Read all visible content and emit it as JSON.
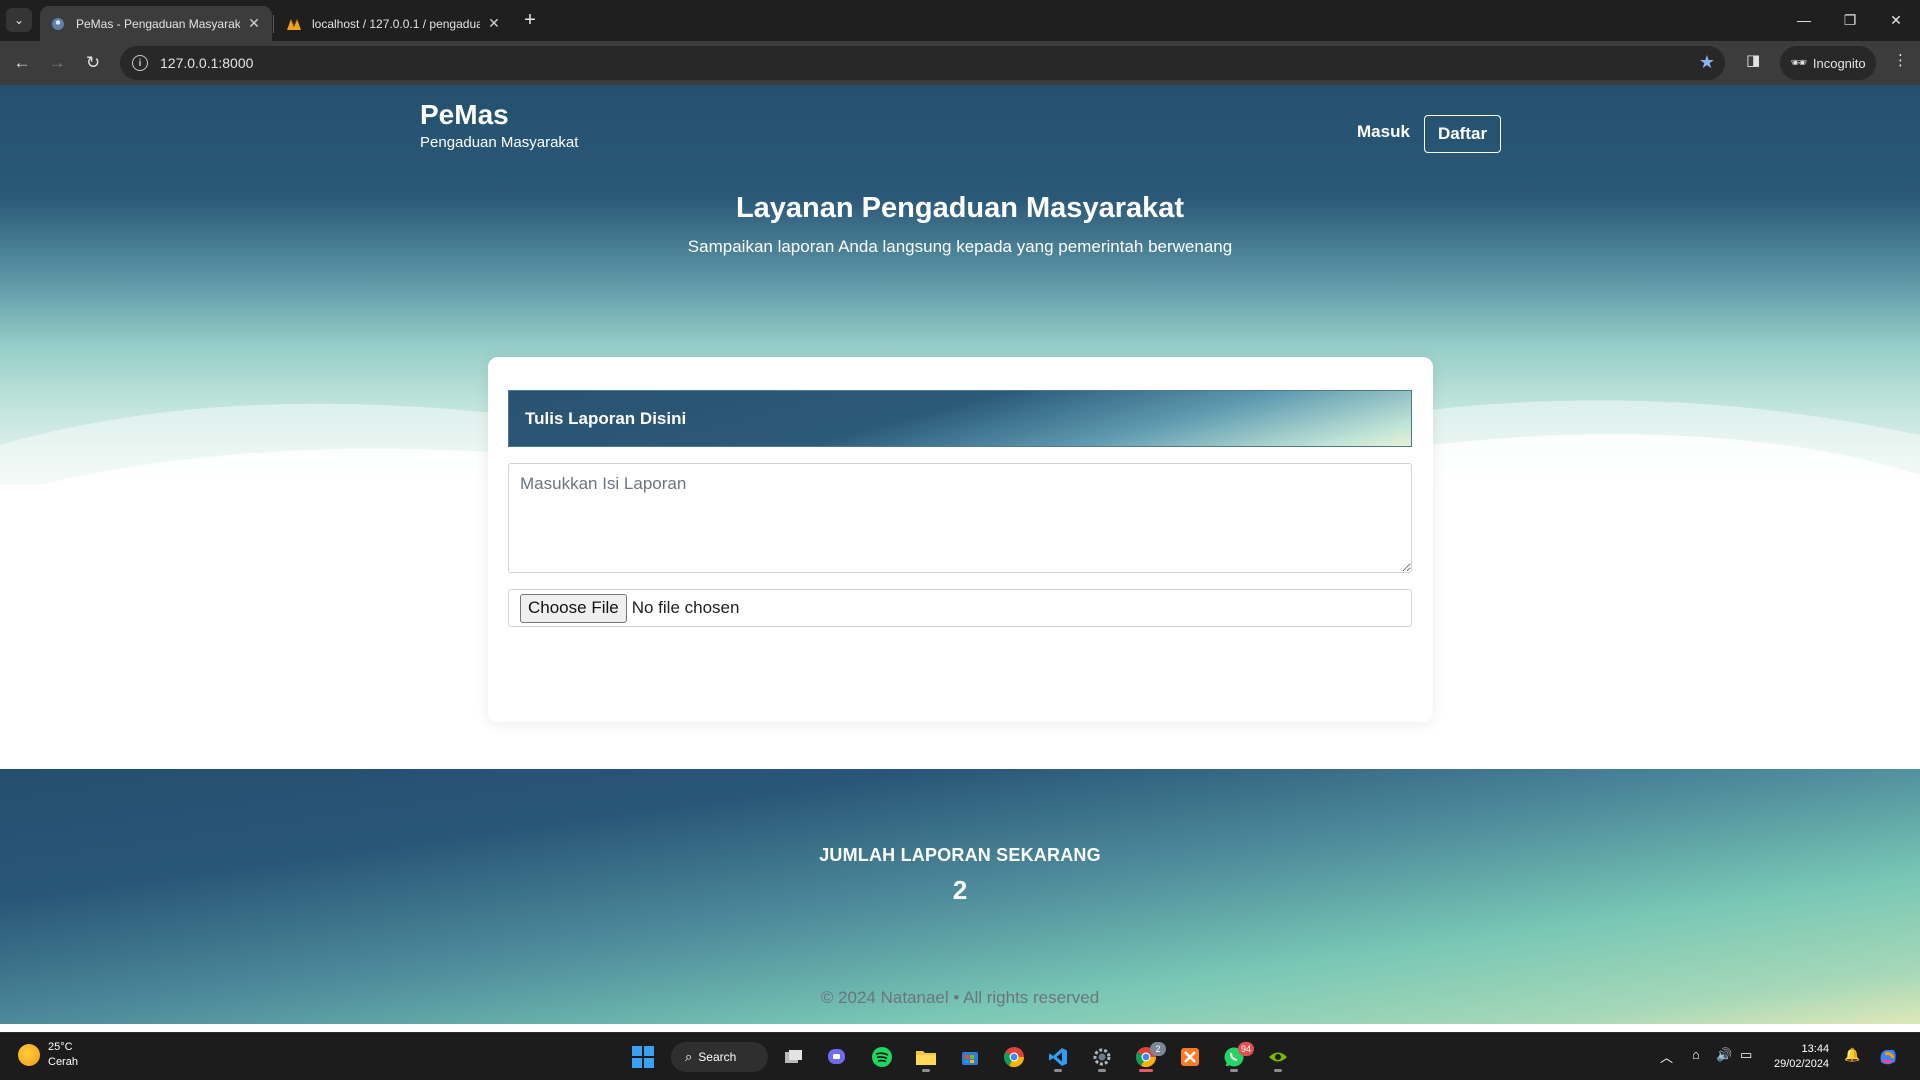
{
  "browser": {
    "tabs": [
      {
        "title": "PeMas - Pengaduan Masyarakat",
        "active": true
      },
      {
        "title": "localhost / 127.0.0.1 / pengaduan",
        "active": false
      }
    ],
    "url": "127.0.0.1:8000",
    "incognito_label": "Incognito"
  },
  "navbar": {
    "brand_title": "PeMas",
    "brand_subtitle": "Pengaduan Masyarakat",
    "login_label": "Masuk",
    "register_label": "Daftar"
  },
  "hero": {
    "title": "Layanan Pengaduan Masyarakat",
    "subtitle": "Sampaikan laporan Anda langsung kepada yang pemerintah berwenang"
  },
  "report_form": {
    "header": "Tulis Laporan Disini",
    "textarea_placeholder": "Masukkan Isi Laporan",
    "file_button_label": "Choose File",
    "file_status": "No file chosen"
  },
  "stats": {
    "label": "JUMLAH LAPORAN SEKARANG",
    "count": "2"
  },
  "footer": {
    "text": "© 2024 Natanael • All rights reserved"
  },
  "taskbar": {
    "weather_temp": "25°C",
    "weather_desc": "Cerah",
    "search_label": "Search",
    "whatsapp_badge": "94",
    "chrome_badge": "2",
    "time": "13:44",
    "date": "29/02/2024"
  },
  "colors": {
    "brand_dark": "#24516f",
    "teal_light": "#98cfc8",
    "footer_text": "#6c757d"
  }
}
